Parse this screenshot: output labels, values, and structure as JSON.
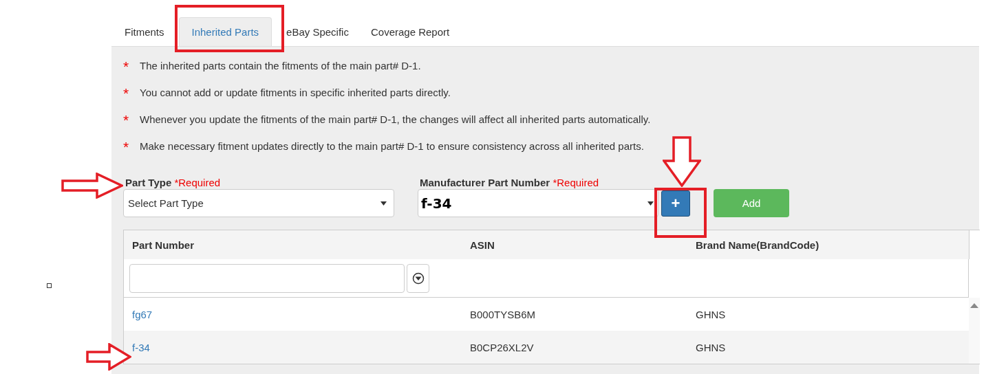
{
  "tabs": [
    {
      "label": "Fitments",
      "selected": false
    },
    {
      "label": "Inherited Parts",
      "selected": true
    },
    {
      "label": "eBay Specific",
      "selected": false
    },
    {
      "label": "Coverage Report",
      "selected": false
    }
  ],
  "notes": [
    "The inherited parts contain the fitments of the main part# D-1.",
    "You cannot add or update fitments in specific inherited parts directly.",
    "Whenever you update the fitments of the main part# D-1, the changes will affect all inherited parts automatically.",
    "Make necessary fitment updates directly to the main part# D-1 to ensure consistency across all inherited parts."
  ],
  "note_marker": "*",
  "part_type": {
    "label": "Part Type",
    "required": "*Required",
    "placeholder": "Select Part Type"
  },
  "manufacturer_part_number": {
    "label": "Manufacturer Part Number",
    "required": "*Required",
    "value": "f-34"
  },
  "plus_button": "+",
  "add_button": "Add",
  "table": {
    "columns": [
      "Part Number",
      "ASIN",
      "Brand Name(BrandCode)"
    ],
    "rows": [
      {
        "part_number": "fg67",
        "asin": "B000TYSB6M",
        "brand": "GHNS"
      },
      {
        "part_number": "f-34",
        "asin": "B0CP26XL2V",
        "brand": "GHNS"
      }
    ]
  }
}
